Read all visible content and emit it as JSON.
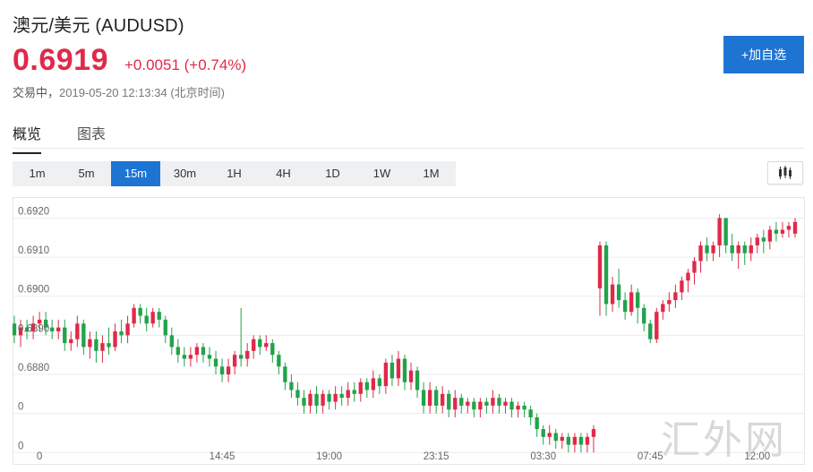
{
  "header": {
    "title": "澳元/美元  (AUDUSD)",
    "price": "0.6919",
    "change": "+0.0051 (+0.74%)",
    "status": "交易中，",
    "timestamp": "2019-05-20 12:13:34 (北京时间)",
    "watch_button": "+加自选"
  },
  "tabs": [
    {
      "label": "概览",
      "active": true
    },
    {
      "label": "图表",
      "active": false
    }
  ],
  "intervals": [
    {
      "label": "1m"
    },
    {
      "label": "5m"
    },
    {
      "label": "15m",
      "active": true
    },
    {
      "label": "30m"
    },
    {
      "label": "1H"
    },
    {
      "label": "4H"
    },
    {
      "label": "1D"
    },
    {
      "label": "1W"
    },
    {
      "label": "1M"
    }
  ],
  "chart_type_icon": "candlestick-icon",
  "colors": {
    "up": "#e0294a",
    "down": "#21a34a",
    "accent": "#1e74d2"
  },
  "watermark": "汇外网",
  "chart_data": {
    "type": "candlestick",
    "y_ticks": [
      "0.6920",
      "0.6910",
      "0.6900",
      "0.6890",
      "0.6880",
      "0",
      "0"
    ],
    "y_tick_values": [
      0.692,
      0.691,
      0.69,
      0.689,
      0.688,
      0.687,
      0.686
    ],
    "x_ticks": [
      {
        "label": "0",
        "index": 4
      },
      {
        "label": "14:45",
        "index": 33
      },
      {
        "label": "19:00",
        "index": 50
      },
      {
        "label": "23:15",
        "index": 67
      },
      {
        "label": "03:30",
        "index": 84
      },
      {
        "label": "07:45",
        "index": 101
      },
      {
        "label": "12:00",
        "index": 118
      }
    ],
    "ylim": [
      0.6858,
      0.6924
    ],
    "candles": [
      [
        0.6893,
        0.689,
        0.6895,
        0.6888
      ],
      [
        0.689,
        0.6892,
        0.6894,
        0.6887
      ],
      [
        0.6892,
        0.6891,
        0.6894,
        0.6889
      ],
      [
        0.6891,
        0.6893,
        0.6895,
        0.6889
      ],
      [
        0.6893,
        0.6894,
        0.6896,
        0.6891
      ],
      [
        0.6894,
        0.6892,
        0.6896,
        0.689
      ],
      [
        0.6892,
        0.6891,
        0.6894,
        0.6889
      ],
      [
        0.6891,
        0.6892,
        0.6894,
        0.6889
      ],
      [
        0.6892,
        0.6888,
        0.6894,
        0.6886
      ],
      [
        0.6888,
        0.6889,
        0.6891,
        0.6886
      ],
      [
        0.6889,
        0.6893,
        0.6895,
        0.6887
      ],
      [
        0.6893,
        0.6887,
        0.6894,
        0.6885
      ],
      [
        0.6887,
        0.6889,
        0.6891,
        0.6884
      ],
      [
        0.6889,
        0.6886,
        0.6891,
        0.6883
      ],
      [
        0.6886,
        0.6888,
        0.689,
        0.6883
      ],
      [
        0.6888,
        0.6887,
        0.6892,
        0.6885
      ],
      [
        0.6887,
        0.6891,
        0.6893,
        0.6886
      ],
      [
        0.6891,
        0.689,
        0.6894,
        0.6888
      ],
      [
        0.689,
        0.6893,
        0.6895,
        0.6888
      ],
      [
        0.6893,
        0.6897,
        0.6898,
        0.6892
      ],
      [
        0.6897,
        0.6895,
        0.6898,
        0.6893
      ],
      [
        0.6895,
        0.6893,
        0.6897,
        0.6891
      ],
      [
        0.6893,
        0.6896,
        0.6897,
        0.6892
      ],
      [
        0.6896,
        0.6894,
        0.6897,
        0.6892
      ],
      [
        0.6894,
        0.689,
        0.6895,
        0.6888
      ],
      [
        0.689,
        0.6887,
        0.6892,
        0.6885
      ],
      [
        0.6887,
        0.6885,
        0.6889,
        0.6883
      ],
      [
        0.6885,
        0.6884,
        0.6887,
        0.6882
      ],
      [
        0.6884,
        0.6885,
        0.6887,
        0.6882
      ],
      [
        0.6885,
        0.6887,
        0.6888,
        0.6883
      ],
      [
        0.6887,
        0.6885,
        0.6888,
        0.6883
      ],
      [
        0.6885,
        0.6884,
        0.6887,
        0.6882
      ],
      [
        0.6884,
        0.6882,
        0.6886,
        0.688
      ],
      [
        0.6882,
        0.688,
        0.6884,
        0.6878
      ],
      [
        0.688,
        0.6882,
        0.6884,
        0.6878
      ],
      [
        0.6882,
        0.6885,
        0.6886,
        0.688
      ],
      [
        0.6885,
        0.6884,
        0.6897,
        0.6882
      ],
      [
        0.6884,
        0.6886,
        0.6888,
        0.6882
      ],
      [
        0.6886,
        0.6889,
        0.689,
        0.6884
      ],
      [
        0.6889,
        0.6887,
        0.689,
        0.6885
      ],
      [
        0.6887,
        0.6888,
        0.689,
        0.6886
      ],
      [
        0.6888,
        0.6885,
        0.6889,
        0.6883
      ],
      [
        0.6885,
        0.6882,
        0.6886,
        0.688
      ],
      [
        0.6882,
        0.6878,
        0.6883,
        0.6876
      ],
      [
        0.6878,
        0.6876,
        0.688,
        0.6874
      ],
      [
        0.6876,
        0.6874,
        0.6878,
        0.6872
      ],
      [
        0.6874,
        0.6872,
        0.6876,
        0.687
      ],
      [
        0.6872,
        0.6875,
        0.6876,
        0.687
      ],
      [
        0.6875,
        0.6872,
        0.6877,
        0.687
      ],
      [
        0.6872,
        0.6875,
        0.6876,
        0.687
      ],
      [
        0.6875,
        0.6873,
        0.6876,
        0.6871
      ],
      [
        0.6873,
        0.6875,
        0.6877,
        0.6871
      ],
      [
        0.6875,
        0.6874,
        0.6877,
        0.6872
      ],
      [
        0.6874,
        0.6876,
        0.6878,
        0.6872
      ],
      [
        0.6876,
        0.6875,
        0.6878,
        0.6873
      ],
      [
        0.6875,
        0.6878,
        0.6879,
        0.6873
      ],
      [
        0.6878,
        0.6876,
        0.6879,
        0.6874
      ],
      [
        0.6876,
        0.6879,
        0.6881,
        0.6874
      ],
      [
        0.6879,
        0.6877,
        0.688,
        0.6875
      ],
      [
        0.6877,
        0.6883,
        0.6884,
        0.6875
      ],
      [
        0.6883,
        0.6879,
        0.6885,
        0.6877
      ],
      [
        0.6879,
        0.6884,
        0.6886,
        0.6877
      ],
      [
        0.6884,
        0.6878,
        0.6885,
        0.6876
      ],
      [
        0.6878,
        0.6881,
        0.6883,
        0.6876
      ],
      [
        0.6881,
        0.6876,
        0.6882,
        0.6874
      ],
      [
        0.6876,
        0.6872,
        0.6878,
        0.687
      ],
      [
        0.6872,
        0.6876,
        0.6878,
        0.687
      ],
      [
        0.6876,
        0.6872,
        0.6877,
        0.687
      ],
      [
        0.6872,
        0.6875,
        0.6877,
        0.687
      ],
      [
        0.6875,
        0.6871,
        0.6876,
        0.6869
      ],
      [
        0.6871,
        0.6874,
        0.6876,
        0.6869
      ],
      [
        0.6874,
        0.6872,
        0.6875,
        0.687
      ],
      [
        0.6872,
        0.6873,
        0.6874,
        0.687
      ],
      [
        0.6873,
        0.6871,
        0.6874,
        0.6869
      ],
      [
        0.6871,
        0.6873,
        0.6874,
        0.6869
      ],
      [
        0.6873,
        0.6872,
        0.6874,
        0.687
      ],
      [
        0.6872,
        0.6874,
        0.6876,
        0.687
      ],
      [
        0.6874,
        0.6872,
        0.6875,
        0.687
      ],
      [
        0.6872,
        0.6873,
        0.6874,
        0.687
      ],
      [
        0.6873,
        0.6871,
        0.6874,
        0.6869
      ],
      [
        0.6871,
        0.6872,
        0.6873,
        0.6869
      ],
      [
        0.6872,
        0.6871,
        0.6873,
        0.6869
      ],
      [
        0.6871,
        0.6869,
        0.6872,
        0.6867
      ],
      [
        0.6869,
        0.6866,
        0.687,
        0.6864
      ],
      [
        0.6866,
        0.6864,
        0.6867,
        0.6862
      ],
      [
        0.6864,
        0.6865,
        0.6867,
        0.6862
      ],
      [
        0.6865,
        0.6863,
        0.6866,
        0.6861
      ],
      [
        0.6863,
        0.6864,
        0.6865,
        0.6861
      ],
      [
        0.6864,
        0.6862,
        0.6865,
        0.686
      ],
      [
        0.6862,
        0.6864,
        0.6865,
        0.686
      ],
      [
        0.6864,
        0.6862,
        0.6865,
        0.686
      ],
      [
        0.6862,
        0.6864,
        0.6865,
        0.686
      ],
      [
        0.6864,
        0.6866,
        0.6867,
        0.686
      ],
      [
        0.6902,
        0.6913,
        0.6914,
        0.6895
      ],
      [
        0.6913,
        0.6898,
        0.6914,
        0.6895
      ],
      [
        0.6898,
        0.6903,
        0.6905,
        0.6896
      ],
      [
        0.6903,
        0.6899,
        0.6907,
        0.6897
      ],
      [
        0.6899,
        0.6896,
        0.6901,
        0.6894
      ],
      [
        0.6896,
        0.6901,
        0.6903,
        0.6895
      ],
      [
        0.6901,
        0.6897,
        0.6902,
        0.6893
      ],
      [
        0.6897,
        0.6893,
        0.6898,
        0.6891
      ],
      [
        0.6893,
        0.6889,
        0.6894,
        0.6888
      ],
      [
        0.6889,
        0.6896,
        0.6897,
        0.6888
      ],
      [
        0.6896,
        0.6898,
        0.6899,
        0.6894
      ],
      [
        0.6898,
        0.6899,
        0.6901,
        0.6896
      ],
      [
        0.6899,
        0.6901,
        0.6903,
        0.6897
      ],
      [
        0.6901,
        0.6904,
        0.6905,
        0.6899
      ],
      [
        0.6904,
        0.6906,
        0.6907,
        0.6901
      ],
      [
        0.6906,
        0.6909,
        0.691,
        0.6903
      ],
      [
        0.6909,
        0.6913,
        0.6914,
        0.6906
      ],
      [
        0.6913,
        0.6911,
        0.6915,
        0.6909
      ],
      [
        0.6911,
        0.6913,
        0.6914,
        0.6909
      ],
      [
        0.6913,
        0.692,
        0.6921,
        0.691
      ],
      [
        0.692,
        0.6913,
        0.692,
        0.6911
      ],
      [
        0.6913,
        0.6911,
        0.6916,
        0.6909
      ],
      [
        0.6911,
        0.6913,
        0.6914,
        0.6907
      ],
      [
        0.6913,
        0.6911,
        0.6914,
        0.6908
      ],
      [
        0.6911,
        0.6913,
        0.6915,
        0.6909
      ],
      [
        0.6913,
        0.6915,
        0.6916,
        0.6911
      ],
      [
        0.6915,
        0.6914,
        0.6917,
        0.6911
      ],
      [
        0.6914,
        0.6917,
        0.6918,
        0.6912
      ],
      [
        0.6917,
        0.6916,
        0.6919,
        0.6914
      ],
      [
        0.6916,
        0.6917,
        0.6919,
        0.6915
      ],
      [
        0.6917,
        0.6918,
        0.6919,
        0.6915
      ],
      [
        0.6916,
        0.6919,
        0.692,
        0.6915
      ]
    ]
  }
}
